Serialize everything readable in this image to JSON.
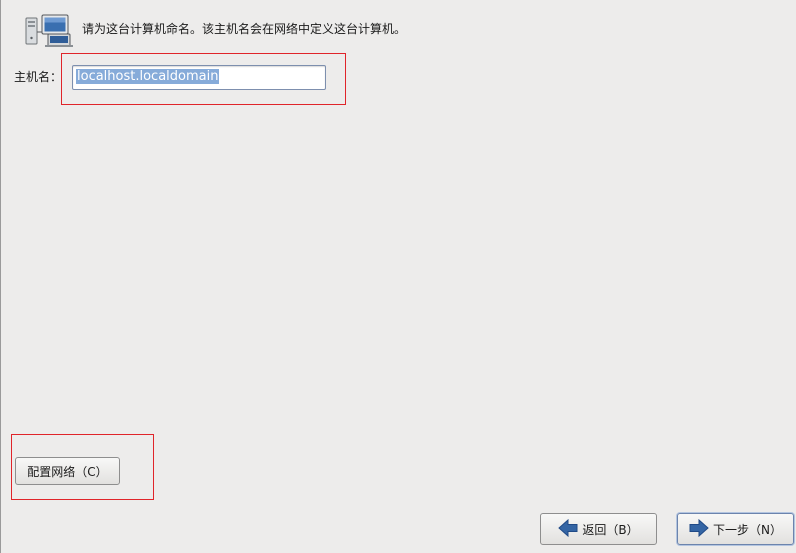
{
  "header": {
    "icon": "network-computers-icon",
    "description": "请为这台计算机命名。该主机名会在网络中定义这台计算机。"
  },
  "hostname": {
    "label": "主机名：",
    "value": "localhost.localdomain"
  },
  "configure_network": {
    "label": "配置网络（C）"
  },
  "nav": {
    "back_label": "返回（B）",
    "back_icon": "arrow-left-icon",
    "next_label": "下一步（N）",
    "next_icon": "arrow-right-icon"
  },
  "colors": {
    "background": "#edeceb",
    "highlight_border": "#e0242a",
    "selection": "#86abd9",
    "arrow": "#3465a4"
  }
}
